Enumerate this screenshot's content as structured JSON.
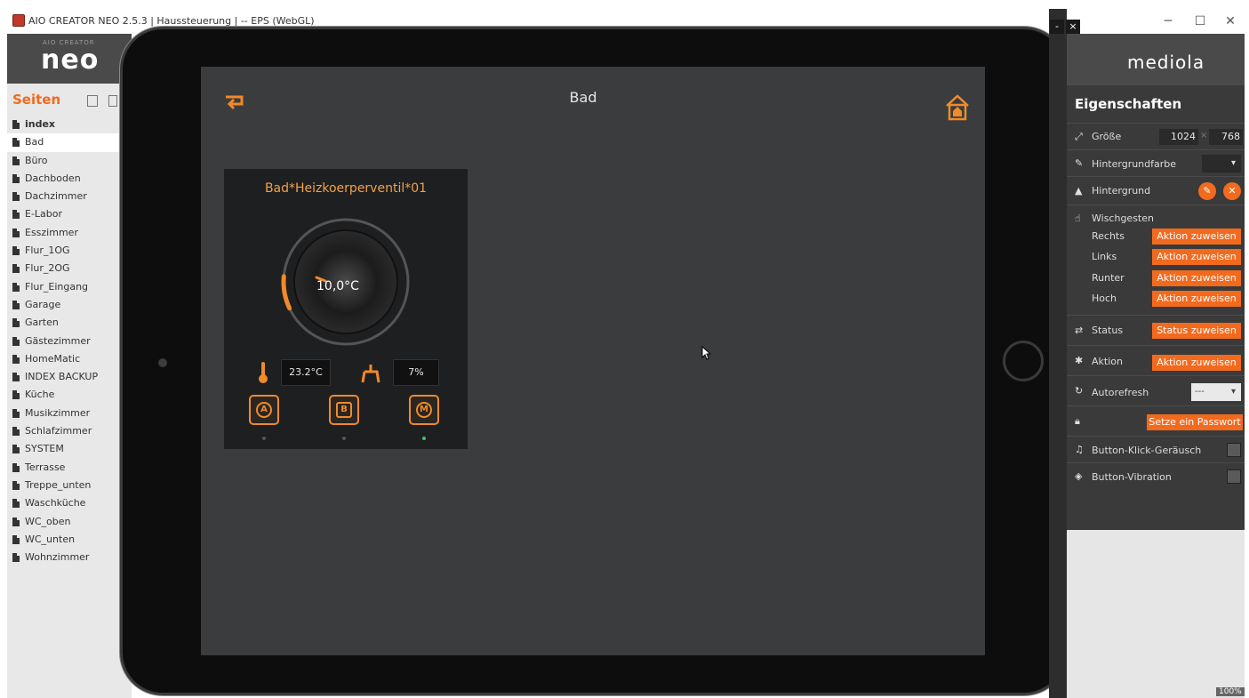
{
  "window": {
    "title": "AIO CREATOR NEO 2.5.3 | Haussteuerung | -- EPS (WebGL)",
    "minimize": "─",
    "maximize": "☐",
    "close": "✕"
  },
  "sidebar": {
    "logo_small": "AIO CREATOR",
    "logo_main": "neo",
    "pages_title": "Seiten",
    "pages": [
      {
        "label": "index"
      },
      {
        "label": "Bad"
      },
      {
        "label": "Büro"
      },
      {
        "label": "Dachboden"
      },
      {
        "label": "Dachzimmer"
      },
      {
        "label": "E-Labor"
      },
      {
        "label": "Esszimmer"
      },
      {
        "label": "Flur_1OG"
      },
      {
        "label": "Flur_2OG"
      },
      {
        "label": "Flur_Eingang"
      },
      {
        "label": "Garage"
      },
      {
        "label": "Garten"
      },
      {
        "label": "Gästezimmer"
      },
      {
        "label": "HomeMatic"
      },
      {
        "label": "INDEX BACKUP"
      },
      {
        "label": "Küche"
      },
      {
        "label": "Musikzimmer"
      },
      {
        "label": "Schlafzimmer"
      },
      {
        "label": "SYSTEM"
      },
      {
        "label": "Terrasse"
      },
      {
        "label": "Treppe_unten"
      },
      {
        "label": "Waschküche"
      },
      {
        "label": "WC_oben"
      },
      {
        "label": "WC_unten"
      },
      {
        "label": "Wohnzimmer"
      }
    ],
    "active_page": "Bad"
  },
  "screen": {
    "title": "Bad",
    "widget": {
      "title": "Bad*Heizkoerperventil*01",
      "setpoint": "10,0°C",
      "setpoint_level": 0.05,
      "current_temp": "23.2°C",
      "valve": "7%",
      "modes": [
        {
          "letter": "A",
          "name": "auto",
          "active": false
        },
        {
          "letter": "B",
          "name": "boost",
          "active": false
        },
        {
          "letter": "M",
          "name": "manual",
          "active": true
        }
      ]
    }
  },
  "properties": {
    "brand": "mediola",
    "header": "Eigenschaften",
    "size_label": "Größe",
    "size_w": "1024",
    "size_sep": "×",
    "size_h": "768",
    "bgcolor_label": "Hintergrundfarbe",
    "bg_label": "Hintergrund",
    "swipe_label": "Wischgesten",
    "swipe": [
      {
        "dir": "Rechts",
        "btn": "Aktion zuweisen"
      },
      {
        "dir": "Links",
        "btn": "Aktion zuweisen"
      },
      {
        "dir": "Runter",
        "btn": "Aktion zuweisen"
      },
      {
        "dir": "Hoch",
        "btn": "Aktion zuweisen"
      }
    ],
    "status_label": "Status",
    "status_btn": "Status zuweisen",
    "action_label": "Aktion",
    "action_btn": "Aktion zuweisen",
    "autorefresh_label": "Autorefresh",
    "autorefresh_value": "---",
    "password_btn": "Setze ein Passwort",
    "click_sound_label": "Button-Klick-Geräusch",
    "vibration_label": "Button-Vibration",
    "zoom": "100%"
  },
  "colors": {
    "accent": "#f26a1e",
    "widget_accent": "#f08a2a",
    "active_led": "#3ec46d"
  }
}
